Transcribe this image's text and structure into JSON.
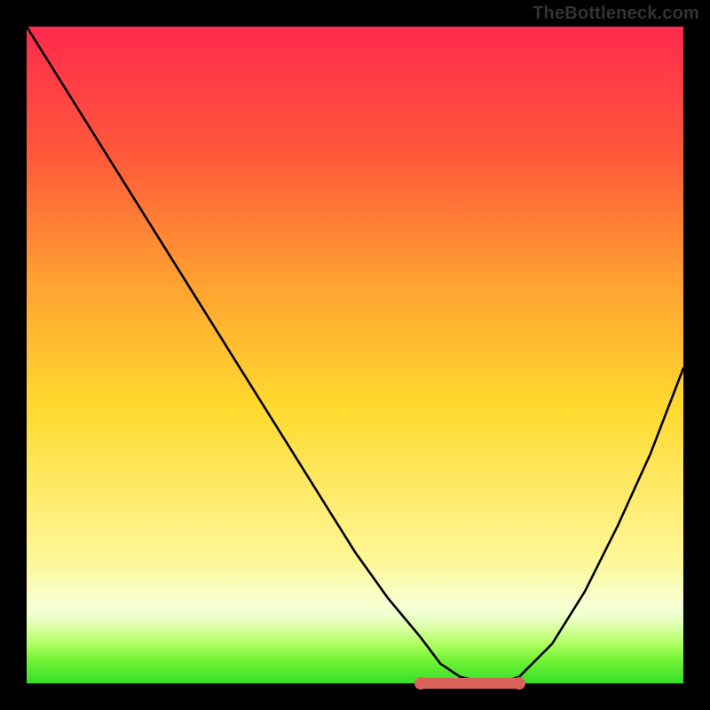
{
  "attribution": "TheBottleneck.com",
  "chart_data": {
    "type": "line",
    "title": "",
    "xlabel": "",
    "ylabel": "",
    "xlim": [
      0,
      100
    ],
    "ylim": [
      0,
      100
    ],
    "series": [
      {
        "name": "bottleneck-curve",
        "x": [
          0,
          5,
          10,
          15,
          20,
          25,
          30,
          35,
          40,
          45,
          50,
          55,
          60,
          63,
          66,
          70,
          72,
          75,
          80,
          85,
          90,
          95,
          100
        ],
        "values": [
          100,
          92,
          84,
          76,
          68,
          60,
          52,
          44,
          36,
          28,
          20,
          13,
          7,
          3,
          1,
          0,
          0,
          1,
          6,
          14,
          24,
          35,
          48
        ]
      },
      {
        "name": "optimal-range-marker",
        "x": [
          60,
          63,
          66,
          70,
          72,
          75
        ],
        "values": [
          0,
          0,
          0,
          0,
          0,
          0
        ]
      }
    ],
    "annotations": [],
    "colors": {
      "curve": "#000000",
      "marker": "#d9635b",
      "gradient_top": "#ff2a4d",
      "gradient_mid": "#ffd92e",
      "gradient_bottom": "#35e02a"
    }
  }
}
